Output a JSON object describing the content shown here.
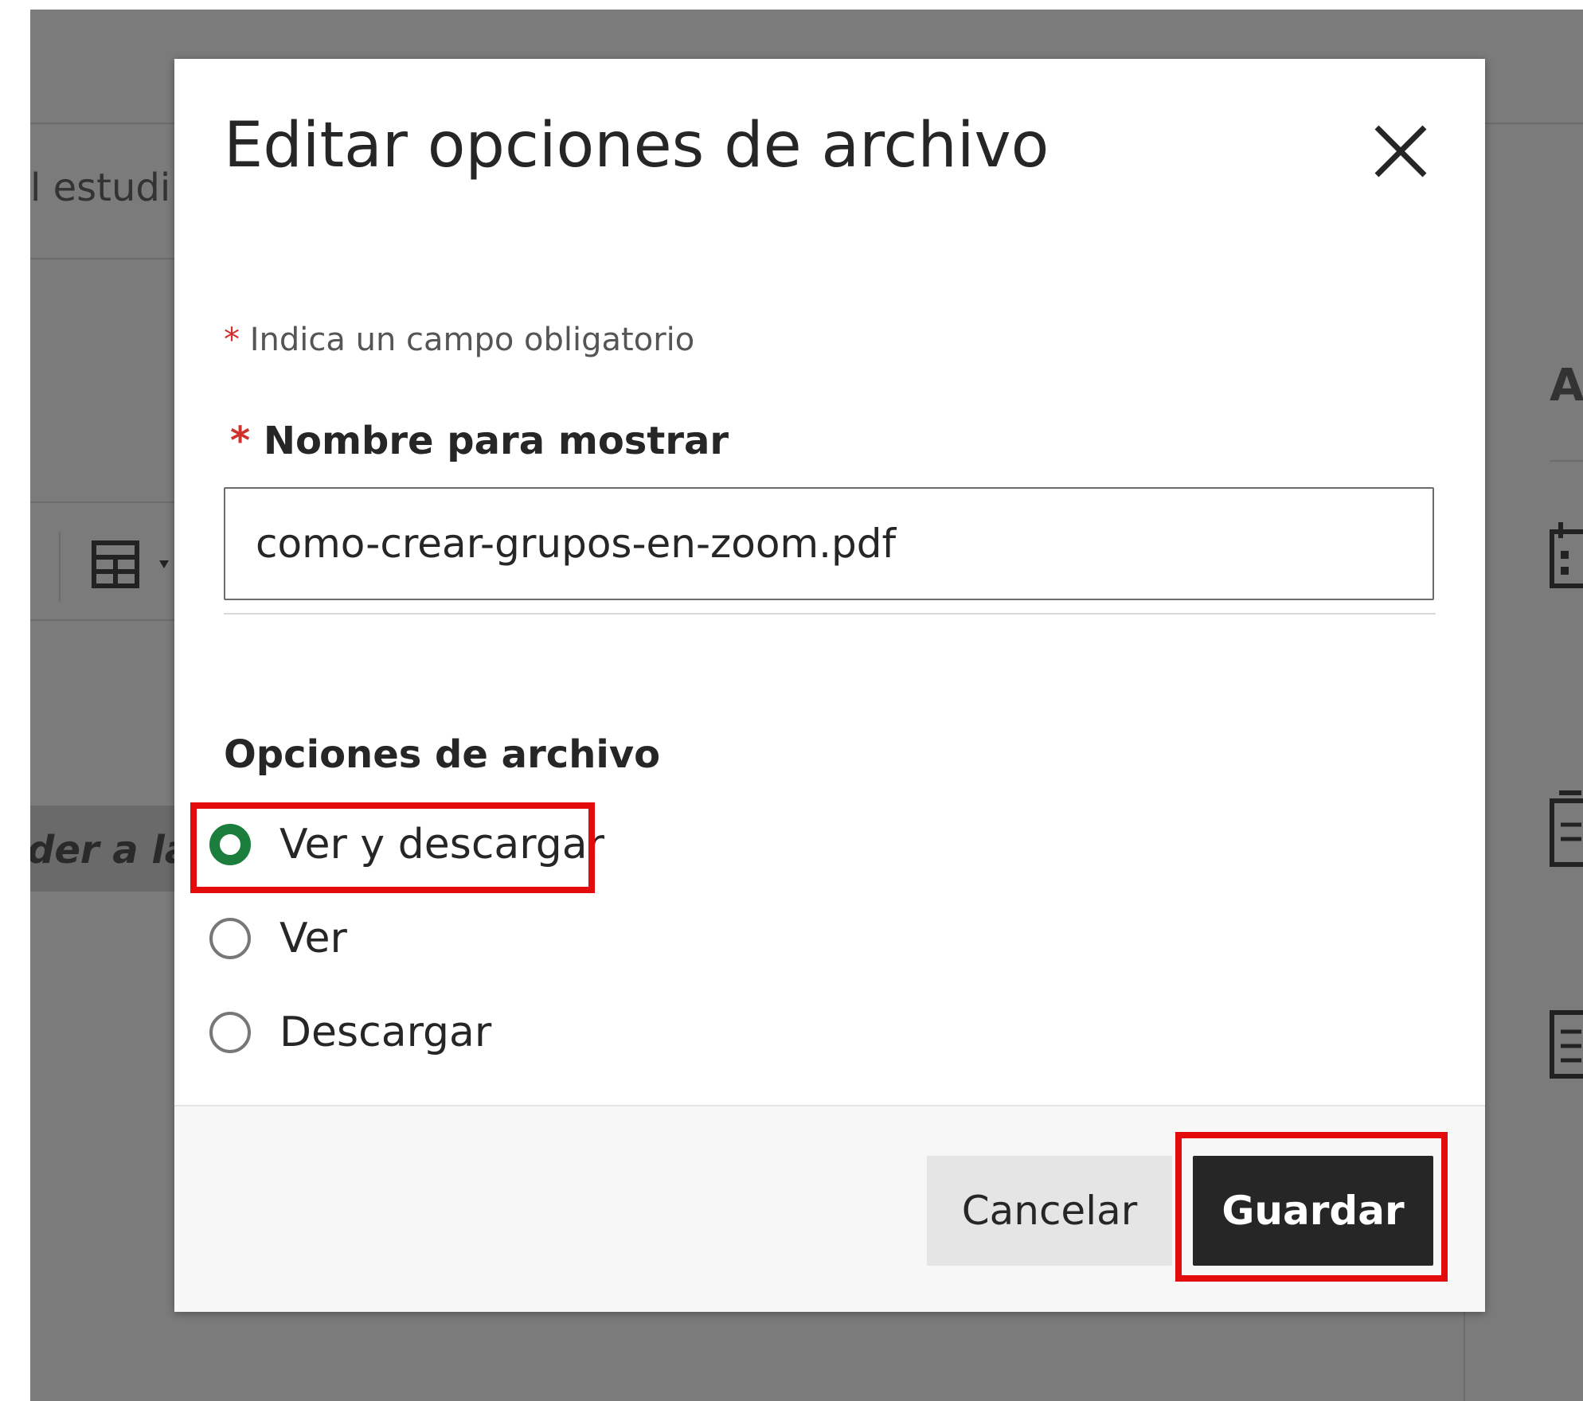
{
  "background": {
    "fragment_students": "l estudi",
    "fragment_italic": "der a la",
    "fragment_right": "A"
  },
  "modal": {
    "title": "Editar opciones de archivo",
    "required_star": "*",
    "required_note": "Indica un campo obligatorio",
    "display_name": {
      "label": "Nombre para mostrar",
      "value": "como-crear-grupos-en-zoom.pdf"
    },
    "file_options": {
      "heading": "Opciones de archivo",
      "options": [
        {
          "label": "Ver y descargar",
          "selected": true
        },
        {
          "label": "Ver",
          "selected": false
        },
        {
          "label": "Descargar",
          "selected": false
        }
      ]
    },
    "footer": {
      "cancel_label": "Cancelar",
      "save_label": "Guardar"
    }
  },
  "colors": {
    "overlay": "#7b7b7b",
    "selected_radio": "#1b7e3c",
    "required_star": "#d0312d",
    "annotation_highlight": "#e30b0b",
    "primary_button": "#262626"
  },
  "icons": [
    "close-icon",
    "table-icon",
    "calendar-icon",
    "document-icon"
  ]
}
